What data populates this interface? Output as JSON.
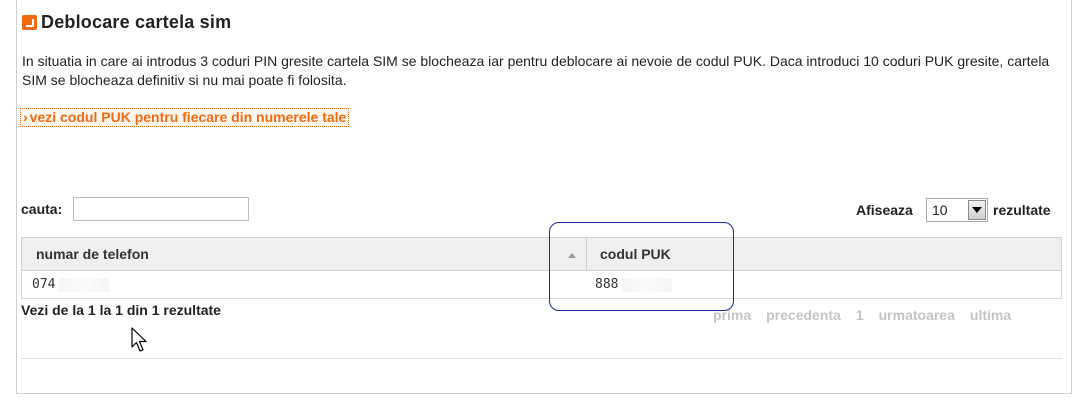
{
  "header": {
    "title": "Deblocare cartela sim",
    "title_icon": "orange-square-arrow-icon"
  },
  "intro": {
    "text": "In situatia in care ai introdus 3 coduri PIN gresite cartela SIM se blocheaza iar pentru deblocare ai nevoie de codul PUK. Daca introduci 10 coduri PUK gresite, cartela SIM se blocheaza definitiv si nu mai poate fi folosita."
  },
  "puk_link": {
    "arrow": "›",
    "label": "vezi codul PUK pentru fiecare din numerele tale"
  },
  "search": {
    "label": "cauta:",
    "value": ""
  },
  "page_size": {
    "label": "Afiseaza",
    "selected": "10",
    "suffix": "rezultate"
  },
  "table": {
    "columns": [
      "numar de telefon",
      "codul PUK"
    ],
    "rows": [
      {
        "phone": "074",
        "puk": "888"
      }
    ]
  },
  "summary": "Vezi de la 1 la 1 din 1 rezultate",
  "pager": {
    "first": "prima",
    "previous": "precedenta",
    "current": "1",
    "next": "urmatoarea",
    "last": "ultima"
  },
  "colors": {
    "accent": "#f26a10",
    "highlight": "#1d27a8",
    "pager_disabled": "#c4c4c4"
  }
}
